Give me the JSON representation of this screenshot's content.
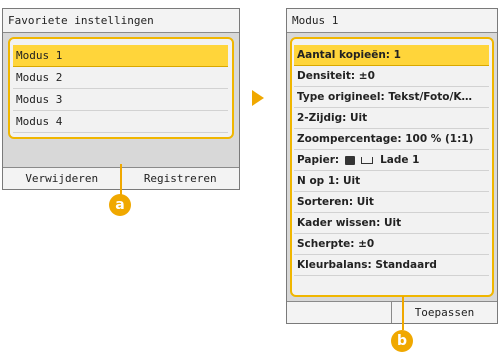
{
  "left_screen": {
    "title": "Favoriete instellingen",
    "items": [
      "Modus 1",
      "Modus 2",
      "Modus 3",
      "Modus 4"
    ],
    "delete_label": "Verwijderen",
    "register_label": "Registreren"
  },
  "right_screen": {
    "title": "Modus 1",
    "settings": [
      "Aantal kopieën: 1",
      "Densiteit: ±0",
      "Type origineel: Tekst/Foto/K…",
      "2-Zijdig: Uit",
      "Zoompercentage: 100 % (1:1)",
      "Papier:",
      "N op 1: Uit",
      "Sorteren: Uit",
      "Kader wissen: Uit",
      "Scherpte: ±0",
      "Kleurbalans: Standaard"
    ],
    "paper_tray": "Lade 1",
    "apply_label": "Toepassen"
  },
  "callouts": {
    "a": "a",
    "b": "b"
  },
  "icons": {
    "arrow": "arrow-right-icon",
    "paper": "paper-icon",
    "tray": "tray-icon"
  },
  "colors": {
    "accent": "#f0a800",
    "selected": "#ffd53a"
  }
}
